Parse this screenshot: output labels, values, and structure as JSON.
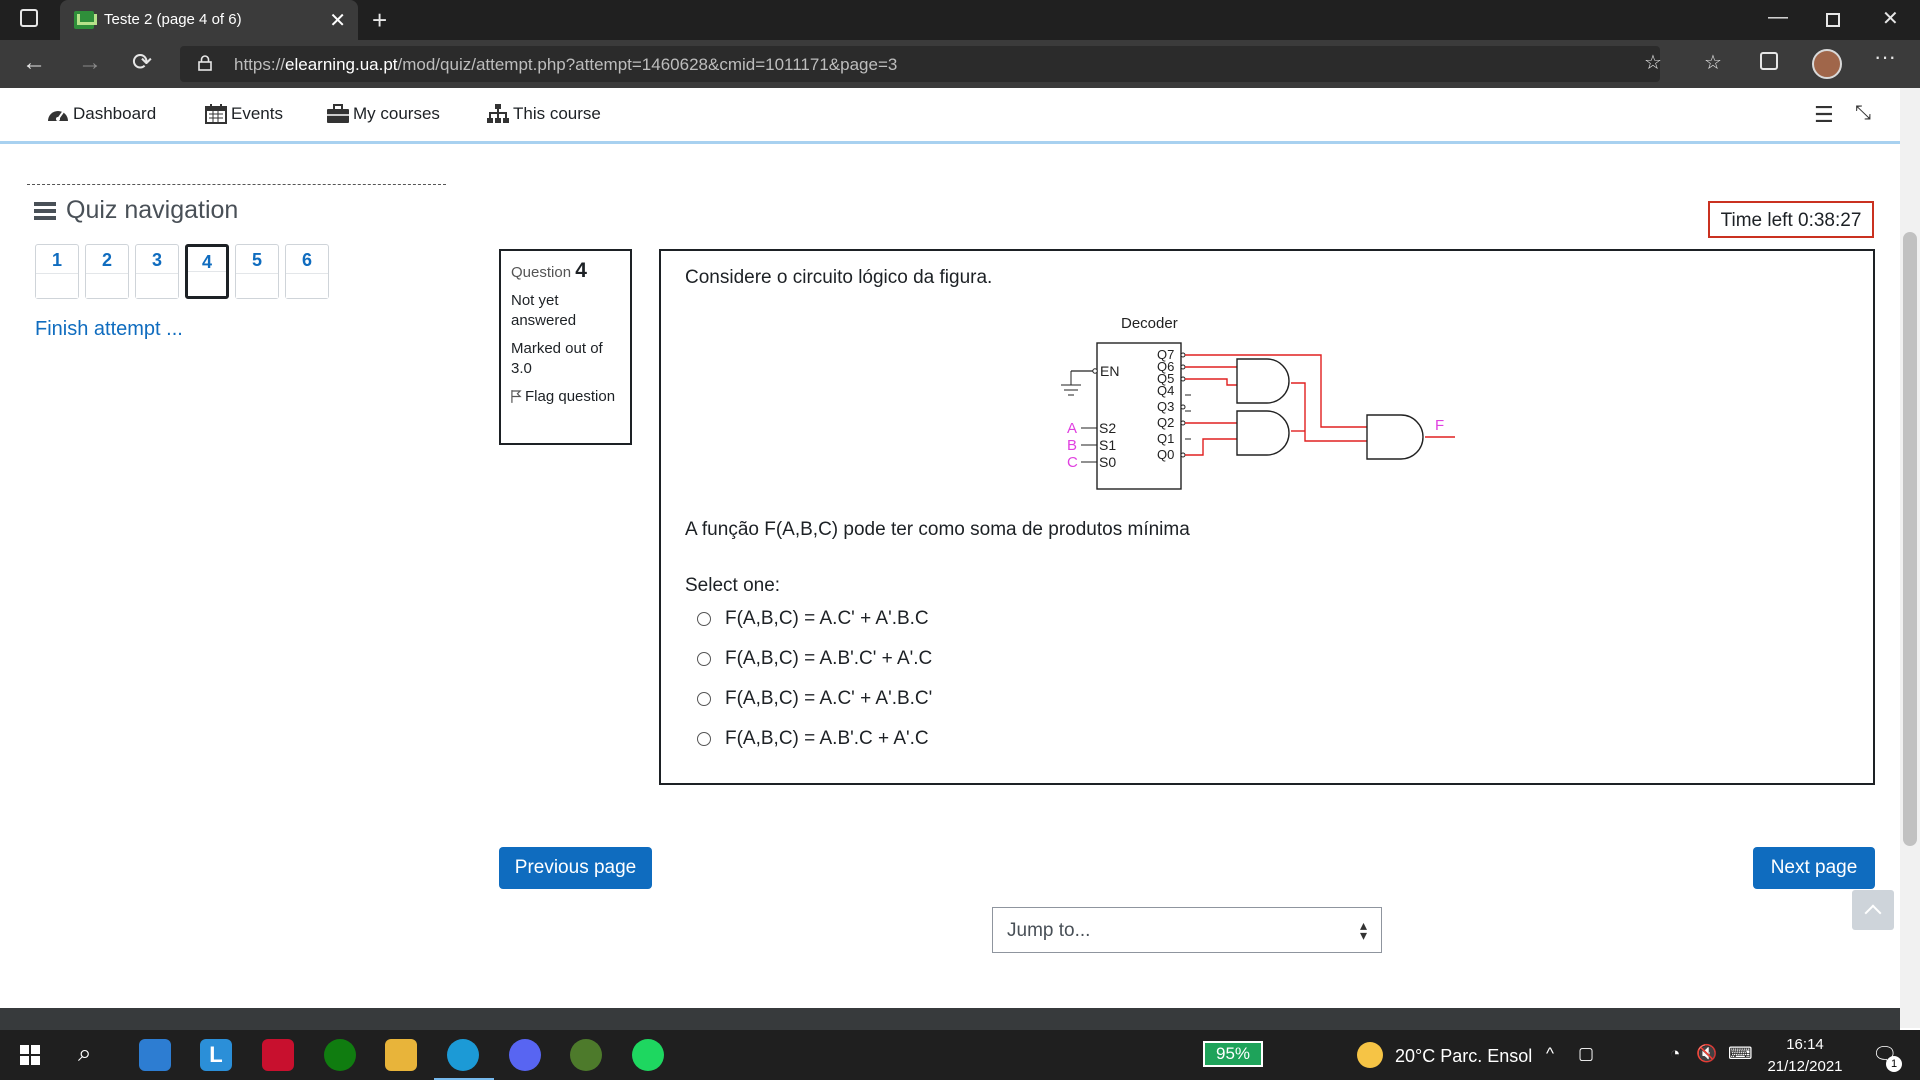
{
  "browser": {
    "tab_title": "Teste 2 (page 4 of 6)",
    "url_prefix": "https://",
    "url_domain": "elearning.ua.pt",
    "url_path": "/mod/quiz/attempt.php?attempt=1460628&cmid=1011171&page=3"
  },
  "navbar": {
    "items": [
      {
        "label": "Dashboard",
        "icon": "tachometer-icon"
      },
      {
        "label": "Events",
        "icon": "calendar-icon"
      },
      {
        "label": "My courses",
        "icon": "briefcase-icon"
      },
      {
        "label": "This course",
        "icon": "sitemap-icon"
      }
    ]
  },
  "quiz_nav": {
    "title": "Quiz navigation",
    "questions": [
      "1",
      "2",
      "3",
      "4",
      "5",
      "6"
    ],
    "current": "4",
    "finish_label": "Finish attempt ..."
  },
  "timer": {
    "label": "Time left 0:38:27"
  },
  "question_info": {
    "label": "Question",
    "number": "4",
    "status": "Not yet answered",
    "marks": "Marked out of 3.0",
    "flag_label": "Flag question"
  },
  "question": {
    "text": "Considere o circuito lógico da figura.",
    "subtext": "A função F(A,B,C) pode ter como soma de produtos mínima",
    "select_label": "Select one:",
    "options": [
      "F(A,B,C) = A.C' + A'.B.C",
      "F(A,B,C) = A.B'.C' + A'.C",
      "F(A,B,C) = A.C' + A'.B.C'",
      "F(A,B,C) = A.B'.C + A'.C"
    ],
    "figure": {
      "decoder_label": "Decoder",
      "en_label": "EN",
      "inputs": [
        {
          "var": "A",
          "pin": "S2"
        },
        {
          "var": "B",
          "pin": "S1"
        },
        {
          "var": "C",
          "pin": "S0"
        }
      ],
      "outputs": [
        "Q7",
        "Q6",
        "Q5",
        "Q4",
        "Q3",
        "Q2",
        "Q1",
        "Q0"
      ],
      "output_label": "F",
      "wire_color": "#e02020",
      "label_color": "#e040e0"
    }
  },
  "navigation": {
    "prev_label": "Previous page",
    "next_label": "Next page",
    "jump_placeholder": "Jump to..."
  },
  "taskbar": {
    "battery": "95%",
    "weather": "20°C  Parc. Ensol",
    "time": "16:14",
    "date": "21/12/2021",
    "notifications": "1"
  }
}
